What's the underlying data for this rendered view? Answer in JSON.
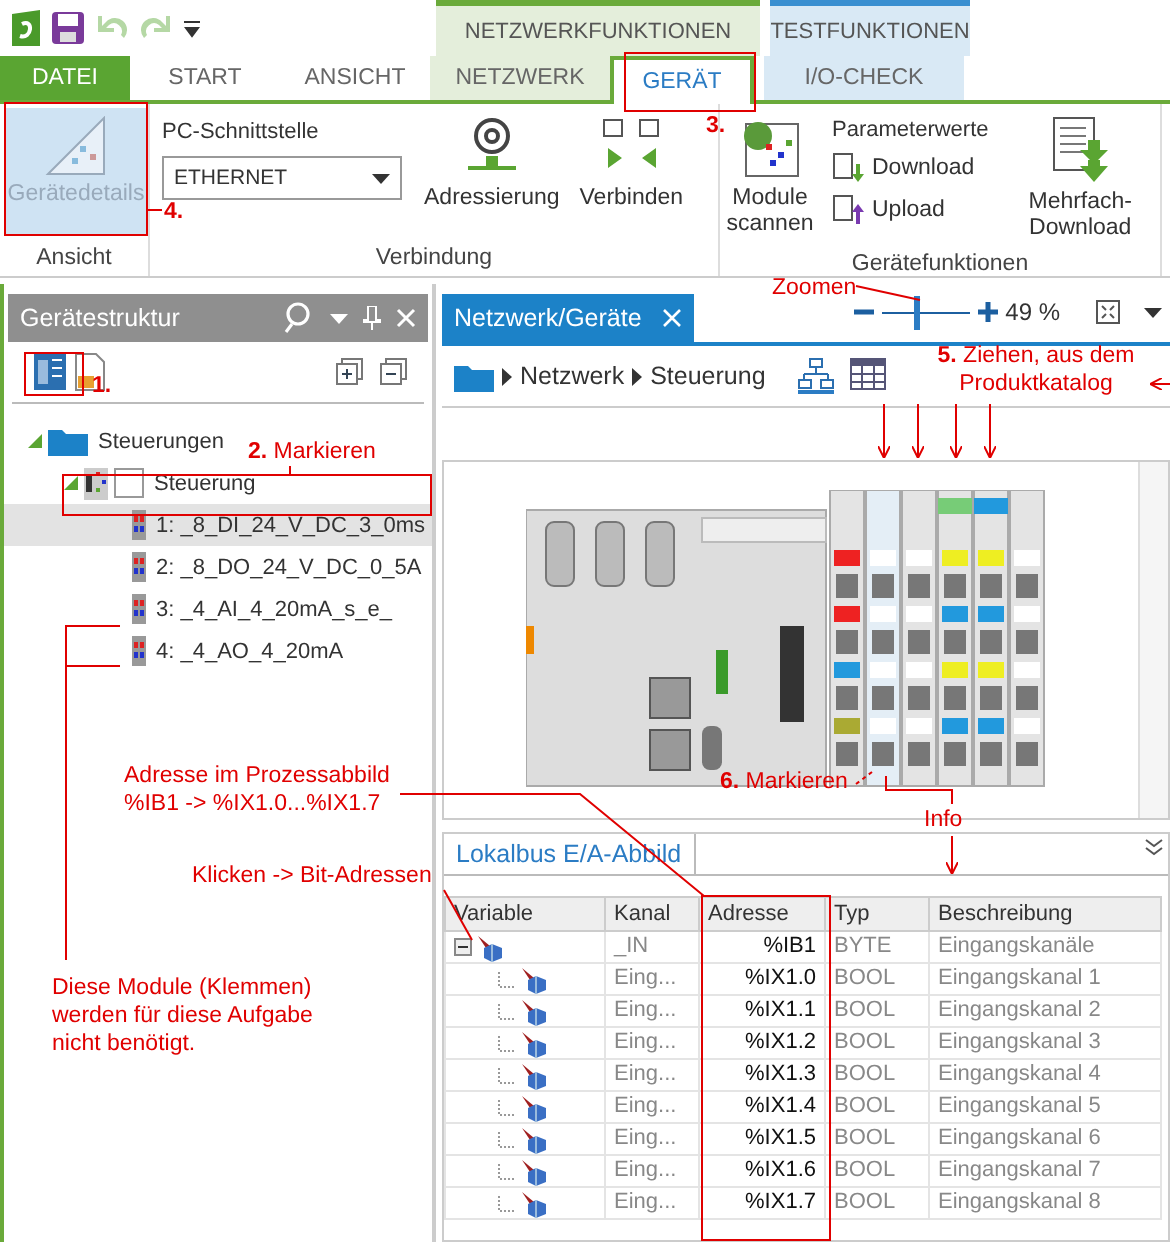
{
  "context_groups": [
    {
      "label": "NETZWERKFUNKTIONEN",
      "color": "#e4eedb"
    },
    {
      "label": "TESTFUNKTIONEN",
      "color": "#d9e9f5"
    }
  ],
  "tabs": [
    {
      "label": "DATEI",
      "kind": "file",
      "selected": false
    },
    {
      "label": "START",
      "kind": "tab",
      "selected": false
    },
    {
      "label": "ANSICHT",
      "kind": "tab",
      "selected": false
    },
    {
      "label": "NETZWERK",
      "kind": "tab",
      "color": "#e4eedb",
      "selected": false
    },
    {
      "label": "GERÄT",
      "kind": "tab",
      "selected": true
    },
    {
      "label": "I/O-CHECK",
      "kind": "tab",
      "color": "#d9e9f5",
      "selected": false
    }
  ],
  "ribbon": [
    {
      "label": "Ansicht",
      "items": [
        {
          "kind": "large",
          "label": "Gerätedetails",
          "disabled": true
        }
      ]
    },
    {
      "label": "Verbindung",
      "items": [
        {
          "kind": "combo",
          "label": "PC-Schnittstelle",
          "value": "ETHERNET"
        },
        {
          "kind": "large",
          "label": "Adressierung",
          "disabled": false
        },
        {
          "kind": "large",
          "label": "Verbinden",
          "disabled": false
        }
      ]
    },
    {
      "label": "Gerätefunktionen",
      "items": [
        {
          "kind": "large",
          "label": "Module scannen",
          "disabled": false
        },
        {
          "kind": "stack",
          "label": "Parameterwerte",
          "buttons": [
            "Download",
            "Upload"
          ]
        },
        {
          "kind": "large",
          "label": "Mehrfach-Download",
          "disabled": false
        }
      ]
    }
  ],
  "device_structure": {
    "title": "Gerätestruktur",
    "tree": [
      {
        "label": "Steuerungen",
        "expanded": true,
        "children": [
          {
            "label": "Steuerung",
            "expanded": true,
            "children": [
              {
                "label": "1: _8_DI_24_V_DC_3_0ms",
                "selected": true
              },
              {
                "label": "2: _8_DO_24_V_DC_0_5A",
                "selected": false
              },
              {
                "label": "3: _4_AI_4_20mA_s_e_",
                "selected": false
              },
              {
                "label": "4: _4_AO_4_20mA",
                "selected": false
              }
            ]
          }
        ]
      }
    ]
  },
  "network_view": {
    "tab": "Netzwerk/Geräte",
    "zoom": {
      "level": 0.4,
      "reading": "49 %"
    },
    "breadcrumb": [
      "Netzwerk",
      "Steuerung"
    ],
    "views": [
      {
        "selected": true
      },
      {
        "selected": false
      }
    ]
  },
  "io_panel": {
    "tab": "Lokalbus E/A-Abbild",
    "columns": [
      "Variable",
      "Kanal",
      "Adresse",
      "Typ",
      "Beschreibung"
    ],
    "rows": [
      {
        "kanal": "_IN",
        "adresse": "%IB1",
        "typ": "BYTE",
        "beschreibung": "Eingangskanäle",
        "expanded": true,
        "children": [
          {
            "kanal": "Eing...",
            "adresse": "%IX1.0",
            "typ": "BOOL",
            "beschreibung": "Eingangskanal 1"
          },
          {
            "kanal": "Eing...",
            "adresse": "%IX1.1",
            "typ": "BOOL",
            "beschreibung": "Eingangskanal 2"
          },
          {
            "kanal": "Eing...",
            "adresse": "%IX1.2",
            "typ": "BOOL",
            "beschreibung": "Eingangskanal 3"
          },
          {
            "kanal": "Eing...",
            "adresse": "%IX1.3",
            "typ": "BOOL",
            "beschreibung": "Eingangskanal 4"
          },
          {
            "kanal": "Eing...",
            "adresse": "%IX1.4",
            "typ": "BOOL",
            "beschreibung": "Eingangskanal 5"
          },
          {
            "kanal": "Eing...",
            "adresse": "%IX1.5",
            "typ": "BOOL",
            "beschreibung": "Eingangskanal 6"
          },
          {
            "kanal": "Eing...",
            "adresse": "%IX1.6",
            "typ": "BOOL",
            "beschreibung": "Eingangskanal 7"
          },
          {
            "kanal": "Eing...",
            "adresse": "%IX1.7",
            "typ": "BOOL",
            "beschreibung": "Eingangskanal 8"
          }
        ]
      }
    ]
  },
  "annotations": [
    "**1.**",
    "**2.** Markieren",
    "**3.**",
    "**4.**",
    "Zoomen",
    "**5.** Ziehen, aus dem Produktkatalog",
    "**6.** Markieren",
    "Info",
    "Adresse im Prozessabbild %IB1 -> %IX1.0...%IX1.7",
    "Klicken -> Bit-Adressen",
    "Diese Module (Klemmen) werden für diese Aufgabe nicht benötigt."
  ]
}
